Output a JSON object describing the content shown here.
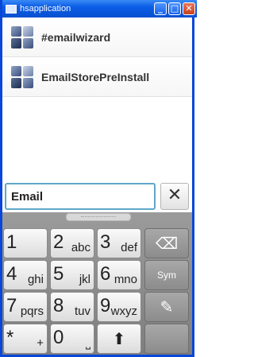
{
  "window": {
    "title": "hsapplication",
    "min_glyph": "_",
    "max_glyph": "□",
    "close_glyph": "✕"
  },
  "list": {
    "items": [
      {
        "label": "#emailwizard"
      },
      {
        "label": "EmailStorePreInstall"
      }
    ]
  },
  "search": {
    "value": "Email",
    "clear_glyph": "✕"
  },
  "keyboard": {
    "keys": [
      {
        "num": "1",
        "letters": ""
      },
      {
        "num": "2",
        "letters": "abc"
      },
      {
        "num": "3",
        "letters": "def"
      },
      {
        "num": "4",
        "letters": "ghi"
      },
      {
        "num": "5",
        "letters": "jkl"
      },
      {
        "num": "6",
        "letters": "mno"
      },
      {
        "num": "7",
        "letters": "pqrs"
      },
      {
        "num": "8",
        "letters": "tuv"
      },
      {
        "num": "9",
        "letters": "wxyz"
      },
      {
        "num": "*",
        "letters": "+"
      },
      {
        "num": "0",
        "letters": "⎵"
      }
    ],
    "backspace_glyph": "⌫",
    "sym_label": "Sym",
    "eraser_glyph": "✎",
    "shift_glyph": "⬆"
  }
}
